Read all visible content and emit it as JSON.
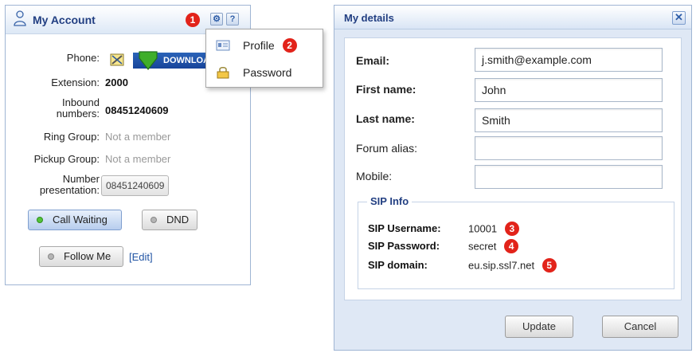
{
  "account_panel": {
    "title": "My Account",
    "phone_label": "Phone:",
    "download_label": "DOWNLOAD",
    "extension_label": "Extension:",
    "extension_value": "2000",
    "inbound_label_1": "Inbound",
    "inbound_label_2": "numbers:",
    "inbound_value": "08451240609",
    "ring_group_label": "Ring Group:",
    "ring_group_value": "Not a member",
    "pickup_group_label": "Pickup Group:",
    "pickup_group_value": "Not a member",
    "number_presentation_label_1": "Number",
    "number_presentation_label_2": "presentation:",
    "number_presentation_value": "08451240609",
    "call_waiting_label": "Call Waiting",
    "dnd_label": "DND",
    "follow_me_label": "Follow Me",
    "edit_link": "[Edit]",
    "settings_button_glyph": "⚙",
    "help_button_glyph": "?",
    "badge_1": "1"
  },
  "menu": {
    "items": [
      {
        "label": "Profile",
        "icon": "profile-card-icon",
        "badge": "2"
      },
      {
        "label": "Password",
        "icon": "lock-icon"
      }
    ]
  },
  "dialog": {
    "title": "My details",
    "close_glyph": "✕",
    "fields": [
      {
        "label": "Email:",
        "value": "j.smith@example.com",
        "bold": true
      },
      {
        "label": "First name:",
        "value": "John",
        "bold": true
      },
      {
        "label": "Last name:",
        "value": "Smith",
        "bold": true
      },
      {
        "label": "Forum alias:",
        "value": "",
        "bold": false
      },
      {
        "label": "Mobile:",
        "value": "",
        "bold": false
      }
    ],
    "sip_legend": "SIP Info",
    "sip": [
      {
        "key": "SIP Username:",
        "value": "10001",
        "badge": "3"
      },
      {
        "key": "SIP Password:",
        "value": "secret",
        "badge": "4"
      },
      {
        "key": "SIP domain:",
        "value": "eu.sip.ssl7.net",
        "badge": "5"
      }
    ],
    "update_label": "Update",
    "cancel_label": "Cancel"
  },
  "colors": {
    "accent": "#223f82",
    "badge": "#e2231a",
    "active_dot": "#54c339"
  }
}
